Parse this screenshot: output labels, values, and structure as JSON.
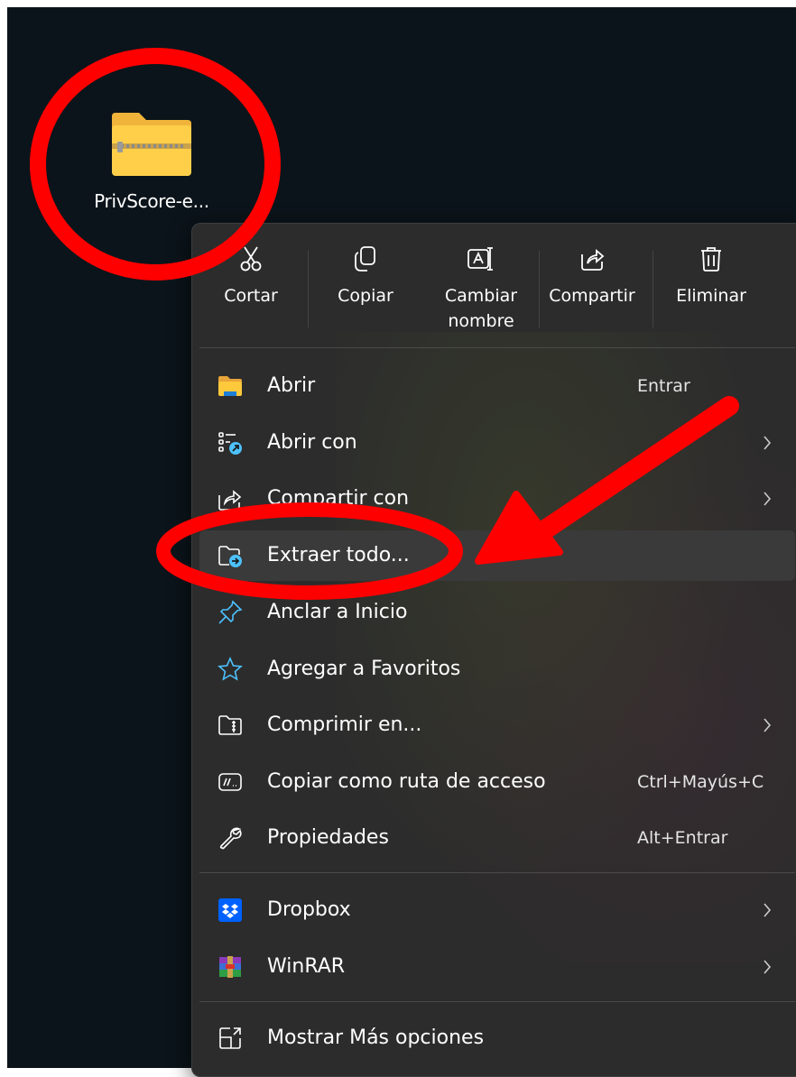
{
  "desktop": {
    "file_label": "PrivScore-e..."
  },
  "quick_actions": [
    {
      "label": "Cortar",
      "icon": "scissors-icon"
    },
    {
      "label": "Copiar",
      "icon": "copy-icon"
    },
    {
      "label": "Cambiar nombre",
      "icon": "rename-icon"
    },
    {
      "label": "Compartir",
      "icon": "share-icon"
    },
    {
      "label": "Eliminar",
      "icon": "trash-icon"
    }
  ],
  "menu_items": [
    {
      "label": "Abrir",
      "shortcut": "Entrar",
      "icon": "folder-icon"
    },
    {
      "label": "Abrir con",
      "icon": "open-with-icon",
      "submenu": true
    },
    {
      "label": "Compartir con",
      "icon": "share-icon",
      "submenu": true
    },
    {
      "label": "Extraer todo...",
      "icon": "extract-icon",
      "highlighted": true
    },
    {
      "label": "Anclar a Inicio",
      "icon": "pin-icon"
    },
    {
      "label": "Agregar a Favoritos",
      "icon": "star-icon"
    },
    {
      "label": "Comprimir en...",
      "icon": "compress-icon",
      "submenu": true
    },
    {
      "label": "Copiar como ruta de acceso",
      "shortcut": "Ctrl+Mayús+C",
      "icon": "path-icon"
    },
    {
      "label": "Propiedades",
      "shortcut": "Alt+Entrar",
      "icon": "wrench-icon"
    },
    {
      "label": "Dropbox",
      "icon": "dropbox-icon",
      "submenu": true
    },
    {
      "label": "WinRAR",
      "icon": "winrar-icon",
      "submenu": true
    },
    {
      "label": "Mostrar Más opciones",
      "icon": "more-options-icon"
    }
  ],
  "colors": {
    "desktop_bg": "#0b141a",
    "menu_bg": "#2c2c2c",
    "highlight": "#3a3a3a",
    "accent_blue": "#4cc2ff",
    "annotation_red": "#ff0000"
  }
}
